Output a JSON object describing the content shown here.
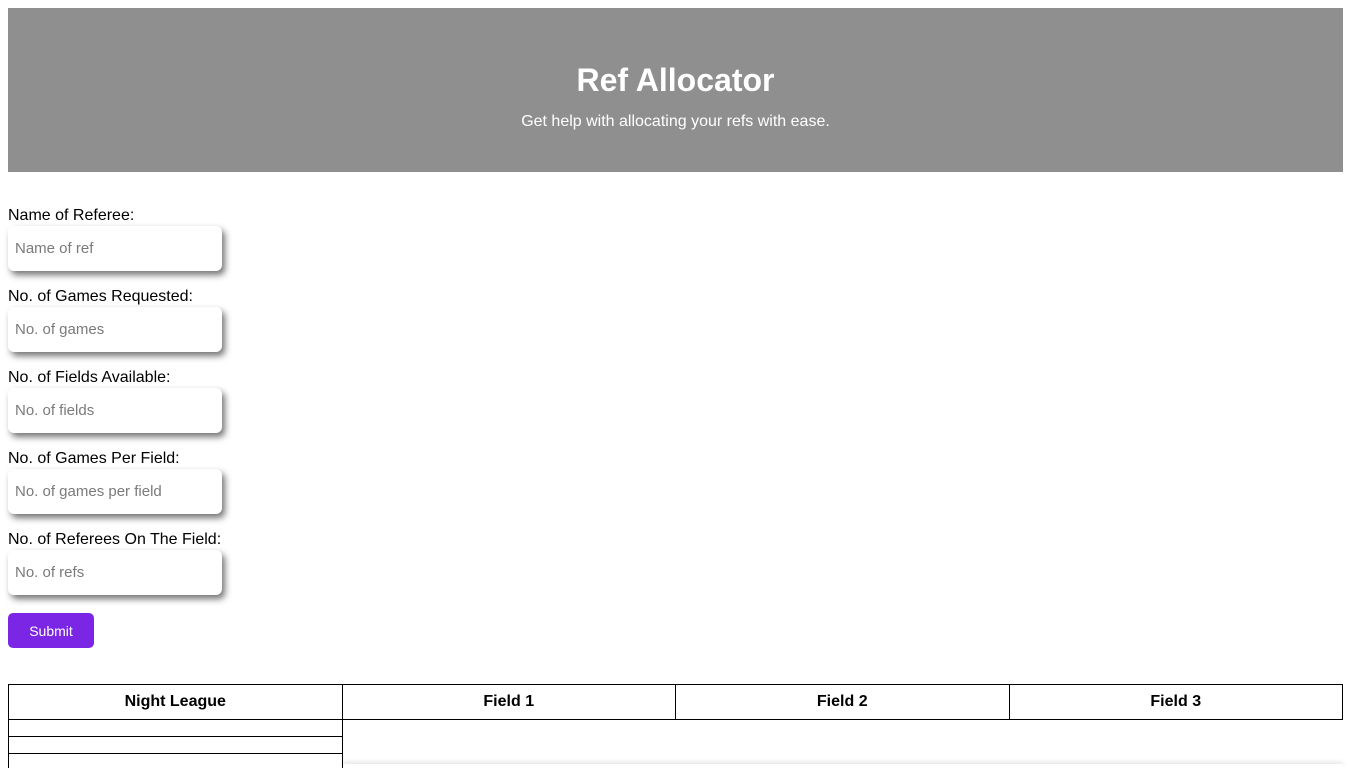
{
  "header": {
    "title": "Ref Allocator",
    "subtitle": "Get help with allocating your refs with ease."
  },
  "form": {
    "fields": [
      {
        "label": "Name of Referee:",
        "placeholder": "Name of ref",
        "value": ""
      },
      {
        "label": "No. of Games Requested:",
        "placeholder": "No. of games",
        "value": ""
      },
      {
        "label": "No. of Fields Available:",
        "placeholder": "No. of fields",
        "value": ""
      },
      {
        "label": "No. of Games Per Field:",
        "placeholder": "No. of games per field",
        "value": ""
      },
      {
        "label": "No. of Referees On The Field:",
        "placeholder": "No. of refs",
        "value": ""
      }
    ],
    "submit_label": "Submit"
  },
  "table": {
    "headers": [
      "Night League",
      "Field 1",
      "Field 2",
      "Field 3"
    ],
    "rows": [
      [
        "",
        "",
        "",
        ""
      ],
      [
        "",
        "",
        "",
        ""
      ],
      [
        "",
        "",
        "",
        ""
      ]
    ]
  },
  "colors": {
    "header_bg": "#8f8f8f",
    "submit_bg": "#7a26e4"
  }
}
